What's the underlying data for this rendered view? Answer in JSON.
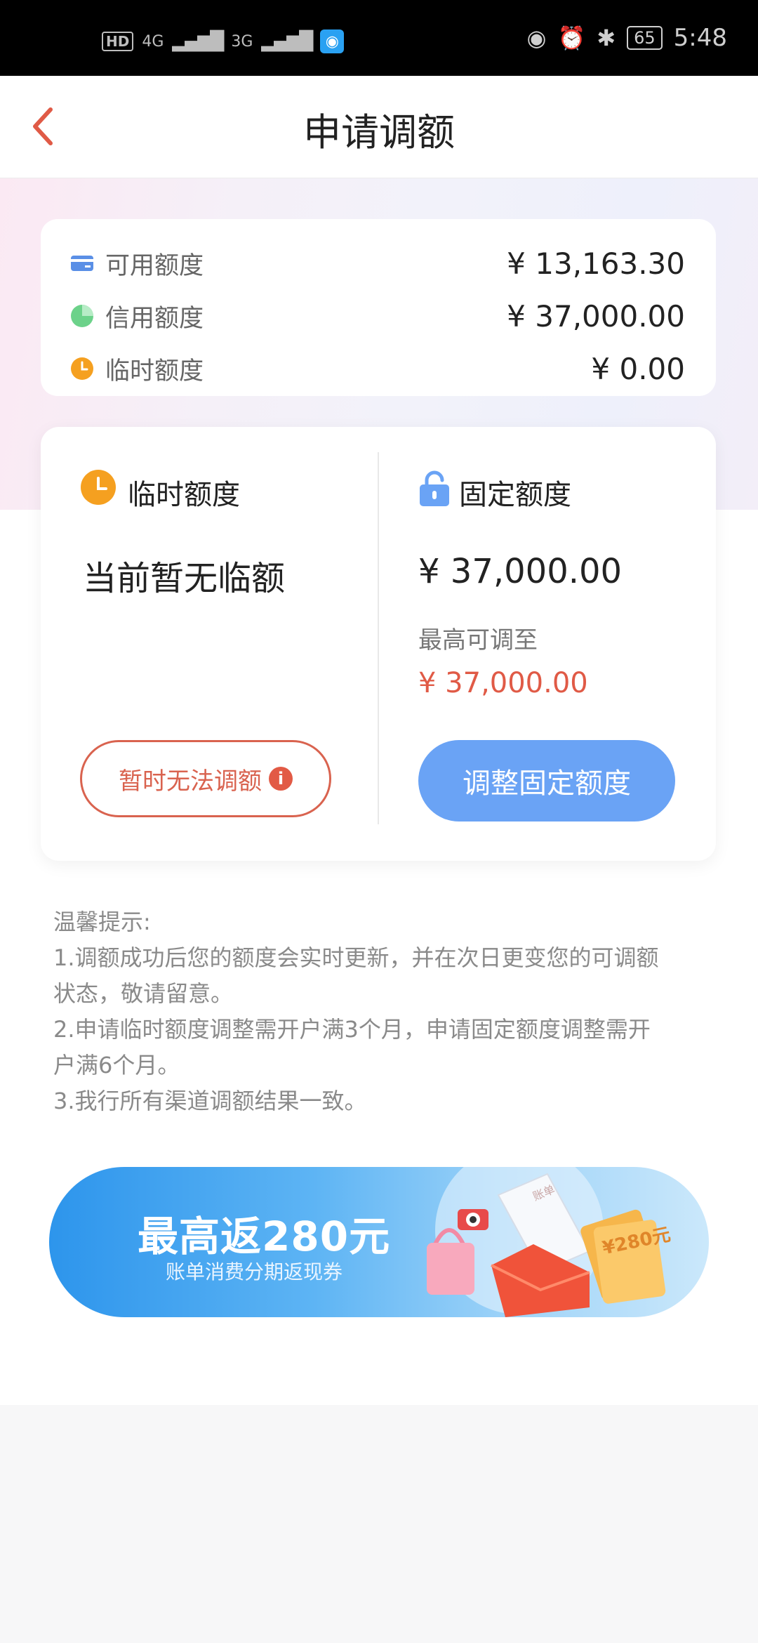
{
  "status_bar": {
    "hd": "HD",
    "net1": "4G",
    "net2": "3G",
    "battery": "65",
    "time": "5:48"
  },
  "nav": {
    "title": "申请调额"
  },
  "summary": {
    "rows": [
      {
        "label": "可用额度",
        "value": "¥ 13,163.30",
        "icon": "card-icon",
        "color": "#5a8fe6"
      },
      {
        "label": "信用额度",
        "value": "¥ 37,000.00",
        "icon": "pie-icon",
        "color": "#6cd28a"
      },
      {
        "label": "临时额度",
        "value": "¥ 0.00",
        "icon": "clock-icon",
        "color": "#f5a020"
      }
    ]
  },
  "temp_quota": {
    "title": "临时额度",
    "status": "当前暂无临额",
    "button": "暂时无法调额",
    "info_glyph": "i"
  },
  "fixed_quota": {
    "title": "固定额度",
    "value": "¥ 37,000.00",
    "max_label": "最高可调至",
    "max_value": "¥ 37,000.00",
    "button": "调整固定额度"
  },
  "tips": {
    "heading": "温馨提示:",
    "lines": [
      "1.调额成功后您的额度会实时更新，并在次日更变您的可调额",
      "状态，敬请留意。",
      "2.申请临时额度调整需开户满3个月，申请固定额度调整需开",
      "户满6个月。",
      "3.我行所有渠道调额结果一致。"
    ]
  },
  "banner": {
    "title": "最高返280元",
    "subtitle": "账单消费分期返现券",
    "ticket_text": "¥280元",
    "bill_text": "账单"
  },
  "colors": {
    "accent_red": "#e05a46",
    "primary_blue": "#6aa3f5",
    "orange": "#f5a020"
  }
}
